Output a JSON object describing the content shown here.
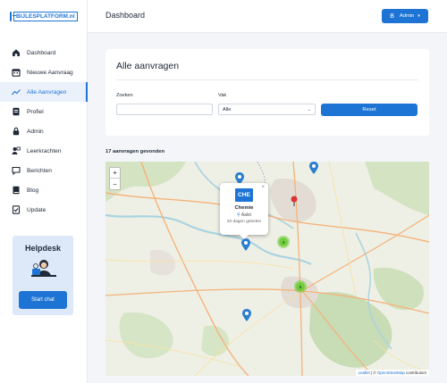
{
  "logo": {
    "text": "BIJLESPLATFORM.nl"
  },
  "header": {
    "title": "Dashboard",
    "admin_label": "Admin",
    "admin_icon": "B"
  },
  "sidebar": {
    "items": [
      {
        "label": "Dashboard",
        "icon": "home-icon",
        "active": false
      },
      {
        "label": "Nieuwe Aanvraag",
        "icon": "calendar-icon",
        "active": false
      },
      {
        "label": "Alle Aanvragen",
        "icon": "chart-line-icon",
        "active": true
      },
      {
        "label": "Profiel",
        "icon": "profile-card-icon",
        "active": false
      },
      {
        "label": "Admin",
        "icon": "lock-icon",
        "active": false
      },
      {
        "label": "Leerkrachten",
        "icon": "teacher-icon",
        "active": false
      },
      {
        "label": "Berichten",
        "icon": "chat-icon",
        "active": false
      },
      {
        "label": "Blog",
        "icon": "book-icon",
        "active": false
      },
      {
        "label": "Update",
        "icon": "update-icon",
        "active": false
      }
    ],
    "helpdesk": {
      "title": "Helpdesk",
      "button": "Start chat"
    }
  },
  "main": {
    "title": "Alle aanvragen",
    "search_label": "Zoeken",
    "search_value": "",
    "subject_label": "Vak",
    "subject_selected": "Alle",
    "reset_label": "Reset",
    "results_text": "17 aanvragen gevonden"
  },
  "map": {
    "zoom_in": "+",
    "zoom_out": "−",
    "popup": {
      "badge": "CHE",
      "subject": "Chemie",
      "city": "Aalst",
      "time": "20 dagen geleden",
      "close": "×"
    },
    "clusters": [
      "3",
      "6"
    ],
    "attribution": {
      "leaflet": "Leaflet",
      "separator": " | © ",
      "osm": "OpenStreetMap",
      "suffix": " contributors"
    },
    "colors": {
      "marker": "#2a7fcf",
      "cluster": "#6ecc39",
      "water": "#aad3df",
      "forest": "#c8dcb5",
      "urban": "#e2dcd4"
    }
  },
  "colors": {
    "accent": "#1e74d4",
    "background": "#f3f5f9"
  }
}
